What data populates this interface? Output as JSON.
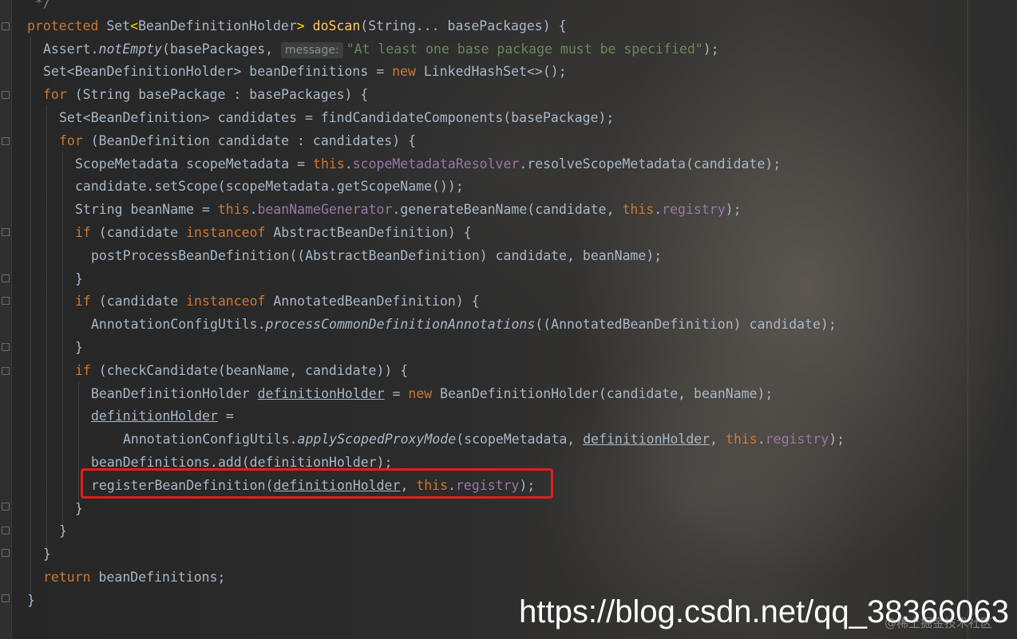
{
  "editor": {
    "code_lines": [
      {
        "indent": 0,
        "html": "<span class='cm'> */</span>"
      },
      {
        "indent": 0,
        "html": "<span class='kw'>protected</span> Set<span class='gen'>&lt;</span>BeanDefinitionHolder<span class='gen'>&gt;</span> <span class='fn'>doScan</span>(String... basePackages) {"
      },
      {
        "indent": 1,
        "html": "Assert.<span class='it'>notEmpty</span>(basePackages, <span class='hint'>message:</span><span class='str'>\"At least one base package must be specified\"</span>);"
      },
      {
        "indent": 1,
        "html": "Set&lt;BeanDefinitionHolder&gt; beanDefinitions = <span class='kw'>new</span> LinkedHashSet&lt;&gt;();"
      },
      {
        "indent": 1,
        "html": "<span class='kw'>for</span> (String basePackage : basePackages) {"
      },
      {
        "indent": 2,
        "html": "Set&lt;BeanDefinition&gt; candidates = findCandidateComponents(basePackage);"
      },
      {
        "indent": 2,
        "html": "<span class='kw'>for</span> (BeanDefinition candidate : candidates) {"
      },
      {
        "indent": 3,
        "html": "ScopeMetadata scopeMetadata = <span class='kw'>this</span>.<span class='fld'>scopeMetadataResolver</span>.resolveScopeMetadata(candidate);"
      },
      {
        "indent": 3,
        "html": "candidate.setScope(scopeMetadata.getScopeName());"
      },
      {
        "indent": 3,
        "html": "String beanName = <span class='kw'>this</span>.<span class='fld'>beanNameGenerator</span>.generateBeanName(candidate, <span class='kw'>this</span>.<span class='fld'>registry</span>);"
      },
      {
        "indent": 3,
        "html": "<span class='kw'>if</span> (candidate <span class='kw'>instanceof</span> AbstractBeanDefinition) {"
      },
      {
        "indent": 4,
        "html": "postProcessBeanDefinition((AbstractBeanDefinition) candidate, beanName);"
      },
      {
        "indent": 3,
        "html": "}"
      },
      {
        "indent": 3,
        "html": "<span class='kw'>if</span> (candidate <span class='kw'>instanceof</span> AnnotatedBeanDefinition) {"
      },
      {
        "indent": 4,
        "html": "AnnotationConfigUtils.<span class='it'>processCommonDefinitionAnnotations</span>((AnnotatedBeanDefinition) candidate);"
      },
      {
        "indent": 3,
        "html": "}"
      },
      {
        "indent": 3,
        "html": "<span class='kw'>if</span> (checkCandidate(beanName, candidate)) {"
      },
      {
        "indent": 4,
        "html": "BeanDefinitionHolder <span class='ul'>definitionHolder</span> = <span class='kw'>new</span> BeanDefinitionHolder(candidate, beanName);"
      },
      {
        "indent": 4,
        "html": "<span class='ul'>definitionHolder</span> ="
      },
      {
        "indent": 6,
        "html": "AnnotationConfigUtils.<span class='it'>applyScopedProxyMode</span>(scopeMetadata, <span class='ul'>definitionHolder</span>, <span class='kw'>this</span>.<span class='fld'>registry</span>);"
      },
      {
        "indent": 4,
        "html": "beanDefinitions.add(definitionHolder);"
      },
      {
        "indent": 4,
        "html": "registerBeanDefinition(<span class='ul'>definitionHolder</span>, <span class='kw'>this</span>.<span class='fld'>registry</span>);"
      },
      {
        "indent": 3,
        "html": "}"
      },
      {
        "indent": 2,
        "html": "}"
      },
      {
        "indent": 1,
        "html": "}"
      },
      {
        "indent": 1,
        "html": "<span class='kw'>return</span> beanDefinitions;"
      },
      {
        "indent": 0,
        "html": "}"
      }
    ]
  },
  "watermark": {
    "url": "https://blog.csdn.net/qq_38366063",
    "faint": "@稀土掘金技术社区"
  }
}
